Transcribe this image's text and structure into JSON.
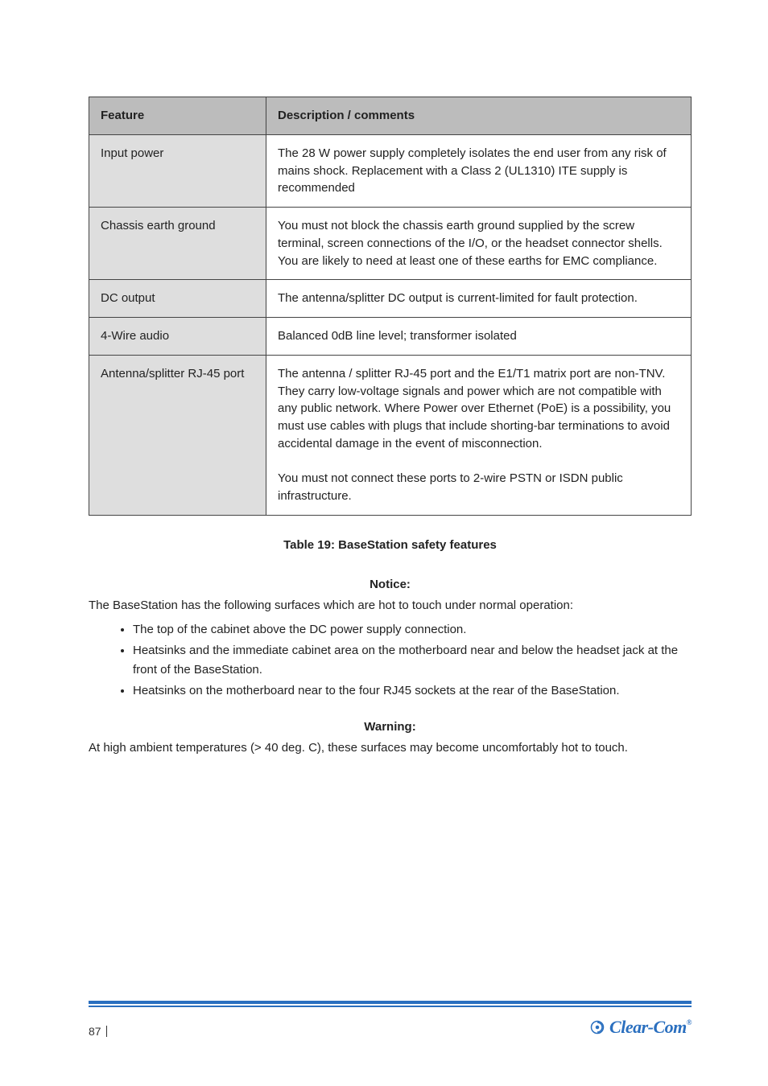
{
  "table": {
    "h1": "Feature",
    "h2": "Description / comments",
    "rows": [
      {
        "label": "Input power",
        "value": "The 28 W power supply completely isolates the end user from any risk of mains shock.  Replacement with a Class 2 (UL1310) ITE supply is recommended"
      },
      {
        "label": "Chassis earth ground",
        "value": "You must not block the chassis earth ground supplied by the screw terminal, screen connections of the I/O, or the headset connector shells. You are likely to need at least one of these earths for EMC compliance."
      },
      {
        "label": "DC output",
        "value": "The antenna/splitter DC output is current-limited for fault protection."
      },
      {
        "label": "4-Wire audio",
        "value": "Balanced 0dB line level; transformer isolated"
      },
      {
        "label": "Antenna/splitter RJ-45 port",
        "value": "The antenna / splitter RJ-45 port and the E1/T1 matrix port are non-TNV. They carry low-voltage signals and power which are not compatible with any public network. Where Power over Ethernet (PoE) is a possibility, you must use cables with plugs that include shorting-bar terminations to avoid accidental damage in the event of misconnection.\n\nYou must not connect these ports to 2-wire PSTN or ISDN public infrastructure."
      }
    ]
  },
  "table_caption": "Table 19: BaseStation safety features",
  "notice": {
    "line1": "Notice:",
    "line2": "The BaseStation has the following surfaces which are hot to touch under normal operation:",
    "bullets": [
      "The top of the cabinet above the DC power supply connection.",
      "Heatsinks and the immediate cabinet area on the motherboard near and below the headset jack at the front of the BaseStation.",
      "Heatsinks on the motherboard near to the four RJ45 sockets at the rear of the BaseStation."
    ]
  },
  "warning": {
    "line1": "Warning:",
    "line2": "At high ambient temperatures (> 40 deg. C), these surfaces may become uncomfortably hot to touch."
  },
  "page_number": "87",
  "logo_text": "Clear-Com"
}
